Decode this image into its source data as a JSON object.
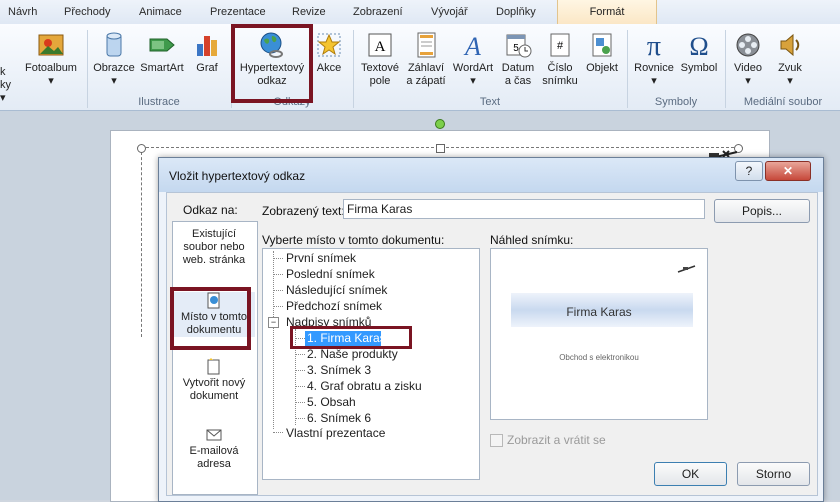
{
  "ribbon": {
    "tabs": [
      "Návrh",
      "Přechody",
      "Animace",
      "Prezentace",
      "Revize",
      "Zobrazení",
      "Vývojář",
      "Doplňky"
    ],
    "context_tab": "Formát",
    "buttons": {
      "left_cut_1": "k",
      "left_cut_2": "ky ▾",
      "fotoalbum": "Fotoalbum",
      "fotoalbum_arrow": "▾",
      "obrazce": "Obrazce",
      "obrazce_arrow": "▾",
      "smartart": "SmartArt",
      "graf": "Graf",
      "hyperlink_1": "Hypertextový",
      "hyperlink_2": "odkaz",
      "akce": "Akce",
      "textove_1": "Textové",
      "textove_2": "pole",
      "zahlavi_1": "Záhlaví",
      "zahlavi_2": "a zápatí",
      "wordart": "WordArt",
      "wordart_arrow": "▾",
      "datum_1": "Datum",
      "datum_2": "a čas",
      "cislo_1": "Číslo",
      "cislo_2": "snímku",
      "objekt": "Objekt",
      "rovnice": "Rovnice",
      "rovnice_arrow": "▾",
      "symbol": "Symbol",
      "video": "Video",
      "video_arrow": "▾",
      "zvuk": "Zvuk",
      "zvuk_arrow": "▾"
    },
    "groups": {
      "ilustrace": "Ilustrace",
      "odkazy": "Odkazy",
      "text": "Text",
      "symboly": "Symboly",
      "media": "Mediální soubor"
    }
  },
  "dialog": {
    "title": "Vložit hypertextový odkaz",
    "help_button": "?",
    "close_button": "✕",
    "link_to_label": "Odkaz na:",
    "link_options": [
      {
        "line1": "Existující",
        "line2": "soubor nebo",
        "line3": "web. stránka"
      },
      {
        "line1": "Místo v tomto",
        "line2": "dokumentu"
      },
      {
        "line1": "Vytvořit nový",
        "line2": "dokument"
      },
      {
        "line1": "E-mailová",
        "line2": "adresa"
      }
    ],
    "display_text_label": "Zobrazený text:",
    "display_text_value": "Firma Karas",
    "screentip_button": "Popis...",
    "select_place_label": "Vyberte místo v tomto dokumentu:",
    "tree": {
      "items": [
        "První snímek",
        "Poslední snímek",
        "Následující snímek",
        "Předchozí snímek"
      ],
      "titles_label": "Nadpisy snímků",
      "slides": [
        "1. Firma Karas",
        "2. Naše produkty",
        "3. Snímek 3",
        "4. Graf obratu a zisku",
        "5. Obsah",
        "6. Snímek 6"
      ],
      "custom_shows": "Vlastní prezentace",
      "expand_glyph": "−"
    },
    "preview_label": "Náhled snímku:",
    "preview": {
      "slide_title": "Firma Karas",
      "slide_subtitle": "Obchod s elektronikou"
    },
    "show_and_return_label": "Zobrazit a vrátit se",
    "ok_button": "OK",
    "cancel_button": "Storno"
  },
  "colors": {
    "highlight_box": "#7a1422",
    "selection": "#3399ff"
  }
}
